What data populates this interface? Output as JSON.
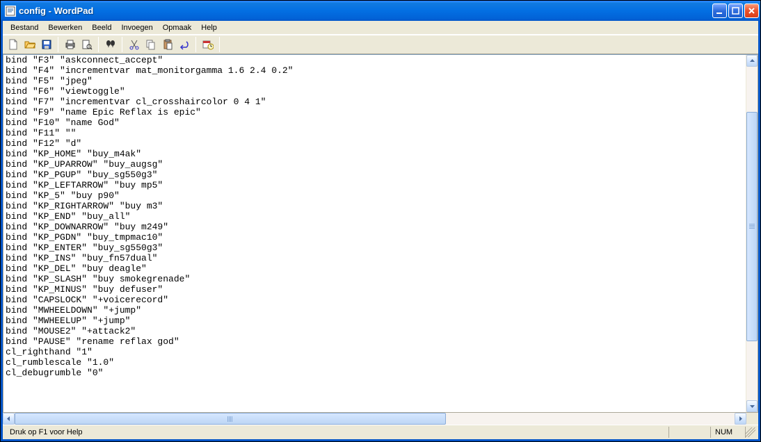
{
  "window": {
    "title": "config - WordPad"
  },
  "menubar": {
    "items": [
      "Bestand",
      "Bewerken",
      "Beeld",
      "Invoegen",
      "Opmaak",
      "Help"
    ]
  },
  "toolbar": {
    "icons": [
      "new-icon",
      "open-icon",
      "save-icon",
      "print-icon",
      "print-preview-icon",
      "find-icon",
      "cut-icon",
      "copy-icon",
      "paste-icon",
      "undo-icon",
      "datetime-icon"
    ]
  },
  "content": {
    "lines": [
      "bind \"F3\" \"askconnect_accept\"",
      "bind \"F4\" \"incrementvar mat_monitorgamma 1.6 2.4 0.2\"",
      "bind \"F5\" \"jpeg\"",
      "bind \"F6\" \"viewtoggle\"",
      "bind \"F7\" \"incrementvar cl_crosshaircolor 0 4 1\"",
      "bind \"F9\" \"name Epic Reflax is epic\"",
      "bind \"F10\" \"name God\"",
      "bind \"F11\" \"\"",
      "bind \"F12\" \"d\"",
      "bind \"KP_HOME\" \"buy_m4ak\"",
      "bind \"KP_UPARROW\" \"buy_augsg\"",
      "bind \"KP_PGUP\" \"buy_sg550g3\"",
      "bind \"KP_LEFTARROW\" \"buy mp5\"",
      "bind \"KP_5\" \"buy p90\"",
      "bind \"KP_RIGHTARROW\" \"buy m3\"",
      "bind \"KP_END\" \"buy_all\"",
      "bind \"KP_DOWNARROW\" \"buy m249\"",
      "bind \"KP_PGDN\" \"buy_tmpmac10\"",
      "bind \"KP_ENTER\" \"buy_sg550g3\"",
      "bind \"KP_INS\" \"buy_fn57dual\"",
      "bind \"KP_DEL\" \"buy deagle\"",
      "bind \"KP_SLASH\" \"buy smokegrenade\"",
      "bind \"KP_MINUS\" \"buy defuser\"",
      "bind \"CAPSLOCK\" \"+voicerecord\"",
      "bind \"MWHEELDOWN\" \"+jump\"",
      "bind \"MWHEELUP\" \"+jump\"",
      "bind \"MOUSE2\" \"+attack2\"",
      "bind \"PAUSE\" \"rename reflax god\"",
      "cl_righthand \"1\"",
      "cl_rumblescale \"1.0\"",
      "cl_debugrumble \"0\""
    ]
  },
  "statusbar": {
    "help_text": "Druk op F1 voor Help",
    "num_label": "NUM"
  }
}
